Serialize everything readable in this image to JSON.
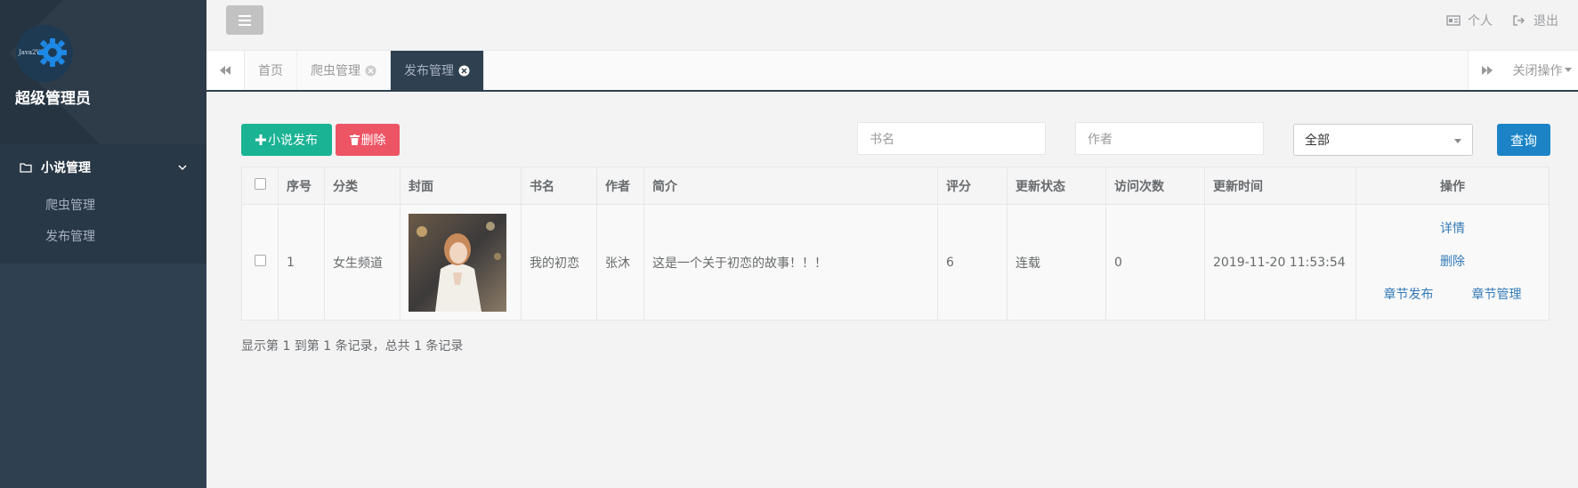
{
  "sidebar": {
    "avatar_text": "Java2Wk",
    "username": "超级管理员",
    "group_label": "小说管理",
    "items": [
      {
        "label": "爬虫管理"
      },
      {
        "label": "发布管理"
      }
    ]
  },
  "topbar": {
    "profile_label": "个人",
    "logout_label": "退出"
  },
  "tabs": {
    "items": [
      {
        "label": "首页"
      },
      {
        "label": "爬虫管理"
      },
      {
        "label": "发布管理"
      }
    ],
    "close_ops_label": "关闭操作"
  },
  "toolbar": {
    "add_label": "小说发布",
    "delete_label": "删除",
    "title_placeholder": "书名",
    "author_placeholder": "作者",
    "select_value": "全部",
    "query_label": "查询"
  },
  "table": {
    "headers": [
      "序号",
      "分类",
      "封面",
      "书名",
      "作者",
      "简介",
      "评分",
      "更新状态",
      "访问次数",
      "更新时间",
      "操作"
    ],
    "rows": [
      {
        "index": "1",
        "category": "女生频道",
        "title": "我的初恋",
        "author": "张沐",
        "intro": "这是一个关于初恋的故事！！！",
        "rating": "6",
        "status": "连载",
        "visits": "0",
        "updated": "2019-11-20 11:53:54",
        "actions": {
          "detail": "详情",
          "delete": "删除",
          "chapter_publish": "章节发布",
          "chapter_manage": "章节管理"
        }
      }
    ]
  },
  "summary": "显示第 1 到第 1 条记录，总共 1 条记录",
  "colors": {
    "sidebar": "#2f4050",
    "primary": "#1ab394",
    "danger": "#ed5565",
    "info": "#1c84c6",
    "link": "#337ab7"
  }
}
